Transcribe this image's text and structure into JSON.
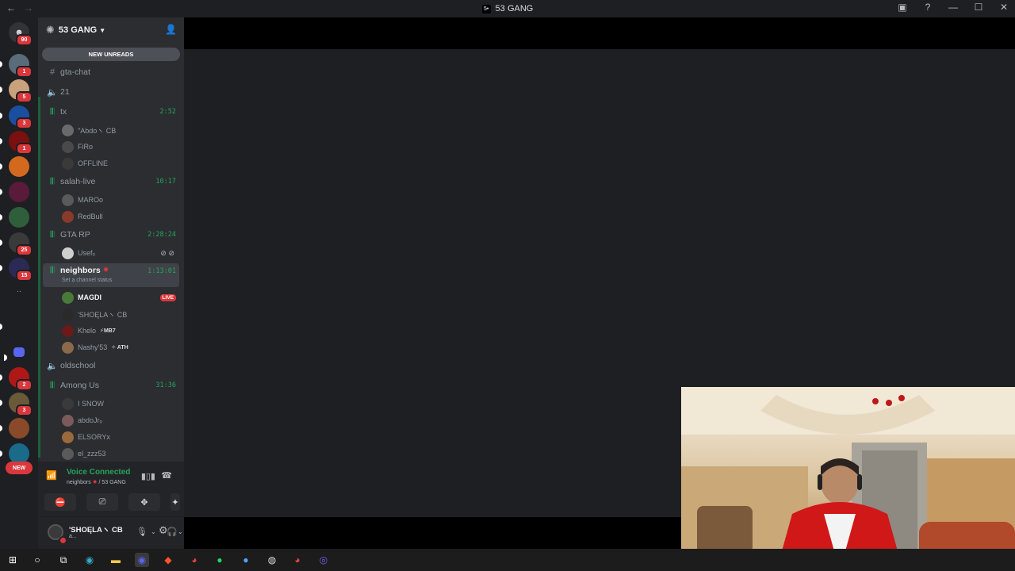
{
  "window": {
    "title": "53 GANG",
    "server_glyph": "5•",
    "nav_back": "←",
    "nav_forward": "→",
    "controls": [
      "screen-icon",
      "help-icon",
      "minimize-icon",
      "maximize-icon",
      "close-icon"
    ]
  },
  "guilds": {
    "home_badge": "90",
    "items": [
      {
        "badge": "1",
        "color": "#5a6b7a"
      },
      {
        "badge": "5",
        "color": "#c9a27c"
      },
      {
        "badge": "3",
        "color": "#1a4fa0"
      },
      {
        "badge": "1",
        "color": "#7a1010"
      },
      {
        "badge": "",
        "color": "#d2691e"
      },
      {
        "badge": "",
        "color": "#5a1a3a"
      },
      {
        "badge": "",
        "color": "#2f5f3a"
      },
      {
        "badge": "25",
        "color": "#3a3a3a"
      },
      {
        "badge": "15",
        "color": "#2a2a55"
      },
      {
        "badge": "",
        "color": "#1e1f22"
      },
      {
        "badge": "",
        "color": "#5865f2"
      },
      {
        "badge": "2",
        "color": "#b01818"
      },
      {
        "badge": "3",
        "color": "#6a5a3a"
      },
      {
        "badge": "",
        "color": "#8a4a2a"
      },
      {
        "badge": "",
        "color": "#1a6a8a"
      }
    ],
    "more": "..",
    "new_label": "NEW"
  },
  "sidebar": {
    "server_name": "53 GANG",
    "new_unreads": "NEW UNREADS",
    "channels": [
      {
        "name": "gta-chat",
        "type": "text",
        "timer": ""
      },
      {
        "name": "21",
        "type": "voice",
        "timer": ""
      },
      {
        "name": "tx",
        "type": "voice-live",
        "timer": "2:52",
        "members": [
          {
            "name": "\"Abdoヽ CB",
            "color": "#6a6a6a"
          },
          {
            "name": "FiRo",
            "color": "#4a4a4a"
          },
          {
            "name": "OFFLINE",
            "color": "#3a3a3a"
          }
        ]
      },
      {
        "name": "salah-live",
        "type": "voice-live",
        "timer": "10:17",
        "members": [
          {
            "name": "MAROo",
            "color": "#5a5a5a"
          },
          {
            "name": "RedBull",
            "color": "#8a3a2a"
          }
        ]
      },
      {
        "name": "GTA RP",
        "type": "voice-live",
        "timer": "2:28:24",
        "members": [
          {
            "name": "Usefₒ",
            "color": "#cfcfcf"
          }
        ]
      },
      {
        "name": "neighbors",
        "type": "voice-live",
        "timer": "1:13:01",
        "status": "Set a channel status",
        "members": [
          {
            "name": "MAGDI",
            "color": "#4a7a3a",
            "live": "LIVE"
          },
          {
            "name": "'SHOĘLAヽ CB",
            "color": "#2a2a2a"
          },
          {
            "name": "Khelo",
            "color": "#6a1a1a",
            "tag": "⚡MB7"
          },
          {
            "name": "Nashy'53",
            "color": "#8a6a4a",
            "tag": "✧ ATH"
          }
        ]
      },
      {
        "name": "oldschool",
        "type": "voice",
        "timer": ""
      },
      {
        "name": "Among Us",
        "type": "voice-live",
        "timer": "31:36",
        "members": [
          {
            "name": "I SNOW",
            "color": "#3a3a3a"
          },
          {
            "name": "abdoJrₒ",
            "color": "#7a5a5a"
          },
          {
            "name": "ELSORYx",
            "color": "#9a6a3a"
          },
          {
            "name": "el_zzz53",
            "color": "#5a5a5a"
          }
        ]
      }
    ]
  },
  "voice": {
    "status": "Voice Connected",
    "location_channel": "neighbors",
    "location_server": "/ 53 GANG"
  },
  "user": {
    "name": "'SHOĘLAヽ CB",
    "status": "a..."
  }
}
